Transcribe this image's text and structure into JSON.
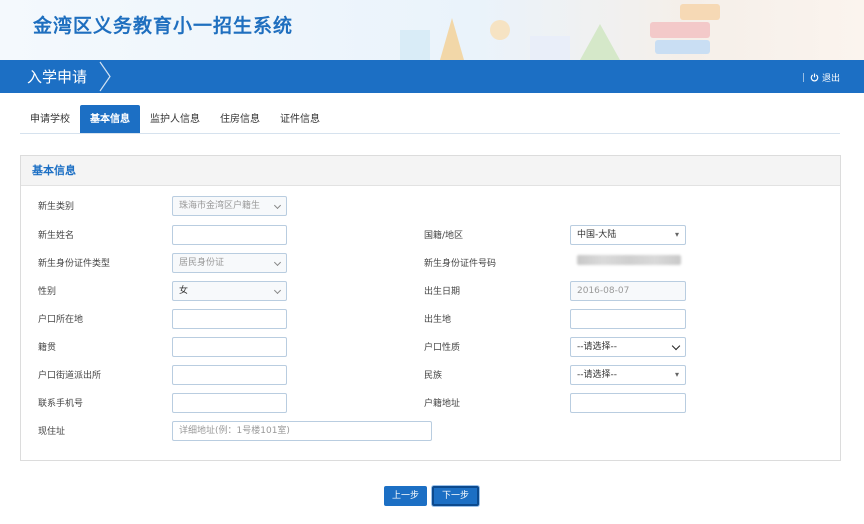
{
  "site_title": "金湾区义务教育小一招生系统",
  "nav": {
    "title": "入学申请",
    "logout_sep": "|",
    "logout_label": "退出"
  },
  "tabs": [
    {
      "label": "申请学校"
    },
    {
      "label": "基本信息"
    },
    {
      "label": "监护人信息"
    },
    {
      "label": "住房信息"
    },
    {
      "label": "证件信息"
    }
  ],
  "panel_title": "基本信息",
  "form": {
    "student_type": {
      "label": "新生类别",
      "value": "珠海市金湾区户籍生"
    },
    "nationality": {
      "label": "国籍/地区",
      "value": "中国-大陆"
    },
    "student_name": {
      "label": "新生姓名",
      "value": ""
    },
    "id_type": {
      "label": "新生身份证件类型",
      "value": "居民身份证"
    },
    "id_number": {
      "label": "新生身份证件号码"
    },
    "gender": {
      "label": "性别",
      "value": "女"
    },
    "birth_date": {
      "label": "出生日期",
      "value": "2016-08-07"
    },
    "hukou_location": {
      "label": "户口所在地",
      "value": ""
    },
    "birthplace": {
      "label": "出生地",
      "value": ""
    },
    "native_place": {
      "label": "籍贯",
      "value": ""
    },
    "hukou_nature": {
      "label": "户口性质",
      "value": "--请选择--"
    },
    "police_station": {
      "label": "户口街道派出所",
      "value": ""
    },
    "ethnicity": {
      "label": "民族",
      "value": "--请选择--"
    },
    "phone": {
      "label": "联系手机号",
      "value": ""
    },
    "hukou_address": {
      "label": "户籍地址",
      "value": ""
    },
    "current_address": {
      "label": "现住址",
      "placeholder": "详细地址(例：1号楼101室)"
    }
  },
  "buttons": {
    "prev": "上一步",
    "next": "下一步"
  },
  "colors": {
    "primary": "#1c6fc4",
    "title": "#1f6fbf"
  }
}
